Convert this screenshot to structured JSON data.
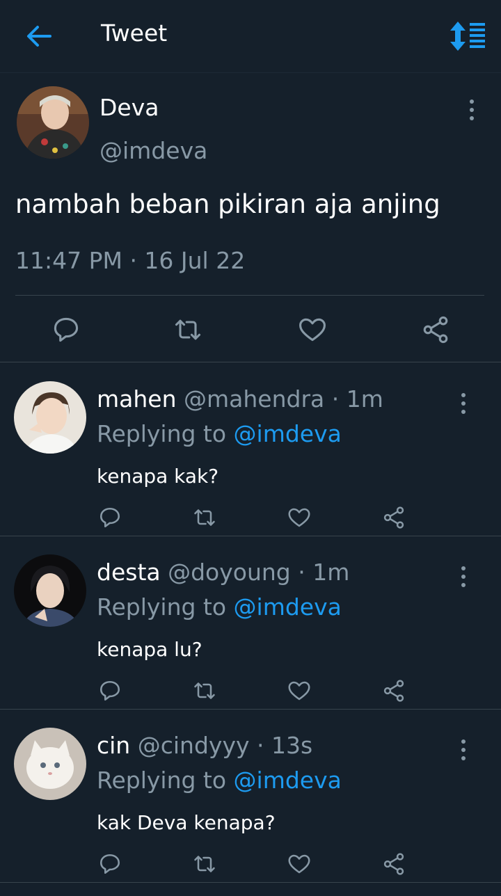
{
  "header": {
    "title": "Tweet",
    "back_icon": "arrow-left-icon",
    "sort_icon": "sort-icon",
    "accent_color": "#1d9bf0"
  },
  "main_tweet": {
    "name": "Deva",
    "handle": "@imdeva",
    "text": "nambah beban pikiran aja anjing",
    "timestamp": "11:47 PM · 16 Jul 22"
  },
  "replies": [
    {
      "name": "mahen",
      "handle": "@mahendra",
      "time": "· 1m",
      "replying_label": "Replying to",
      "replying_to": "@imdeva",
      "text": "kenapa kak?"
    },
    {
      "name": "desta",
      "handle": "@doyoung",
      "time": "· 1m",
      "replying_label": "Replying to",
      "replying_to": "@imdeva",
      "text": "kenapa lu?"
    },
    {
      "name": "cin",
      "handle": "@cindyyy",
      "time": "· 13s",
      "replying_label": "Replying to",
      "replying_to": "@imdeva",
      "text": "kak Deva kenapa?"
    }
  ],
  "colors": {
    "background": "#15202b",
    "secondary_text": "#8899a6",
    "divider": "#38444d",
    "link": "#1d9bf0"
  }
}
